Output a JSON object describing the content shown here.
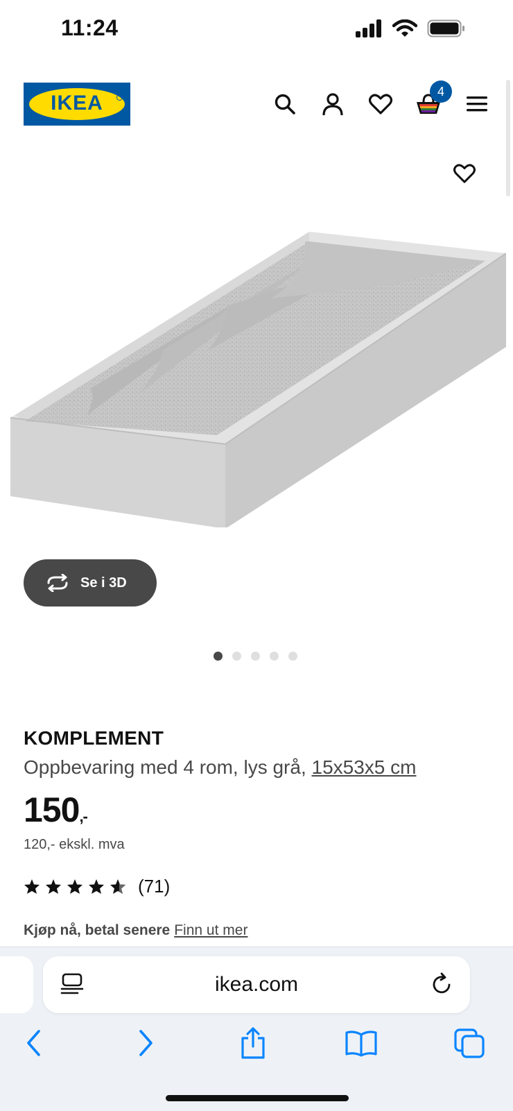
{
  "status_bar": {
    "time": "11:24"
  },
  "header": {
    "logo_text": "IKEA",
    "cart_count": "4"
  },
  "gallery": {
    "view_3d_label": "Se i 3D",
    "dot_count": 5,
    "active_dot": 0
  },
  "product": {
    "name": "KOMPLEMENT",
    "description": "Oppbevaring med 4 rom, lys grå, ",
    "size": "15x53x5 cm",
    "price": "150",
    "price_suffix": ",-",
    "price_ex_vat": "120,- ekskl. mva",
    "rating": 4.5,
    "rating_count": "(71)",
    "bnpl_lead": "Kjøp nå, betal senere",
    "bnpl_link": "Finn ut mer"
  },
  "browser": {
    "url": "ikea.com"
  },
  "colors": {
    "ikea_blue": "#0058a3",
    "ikea_yellow": "#ffdb00",
    "safari_blue": "#0a84ff"
  }
}
